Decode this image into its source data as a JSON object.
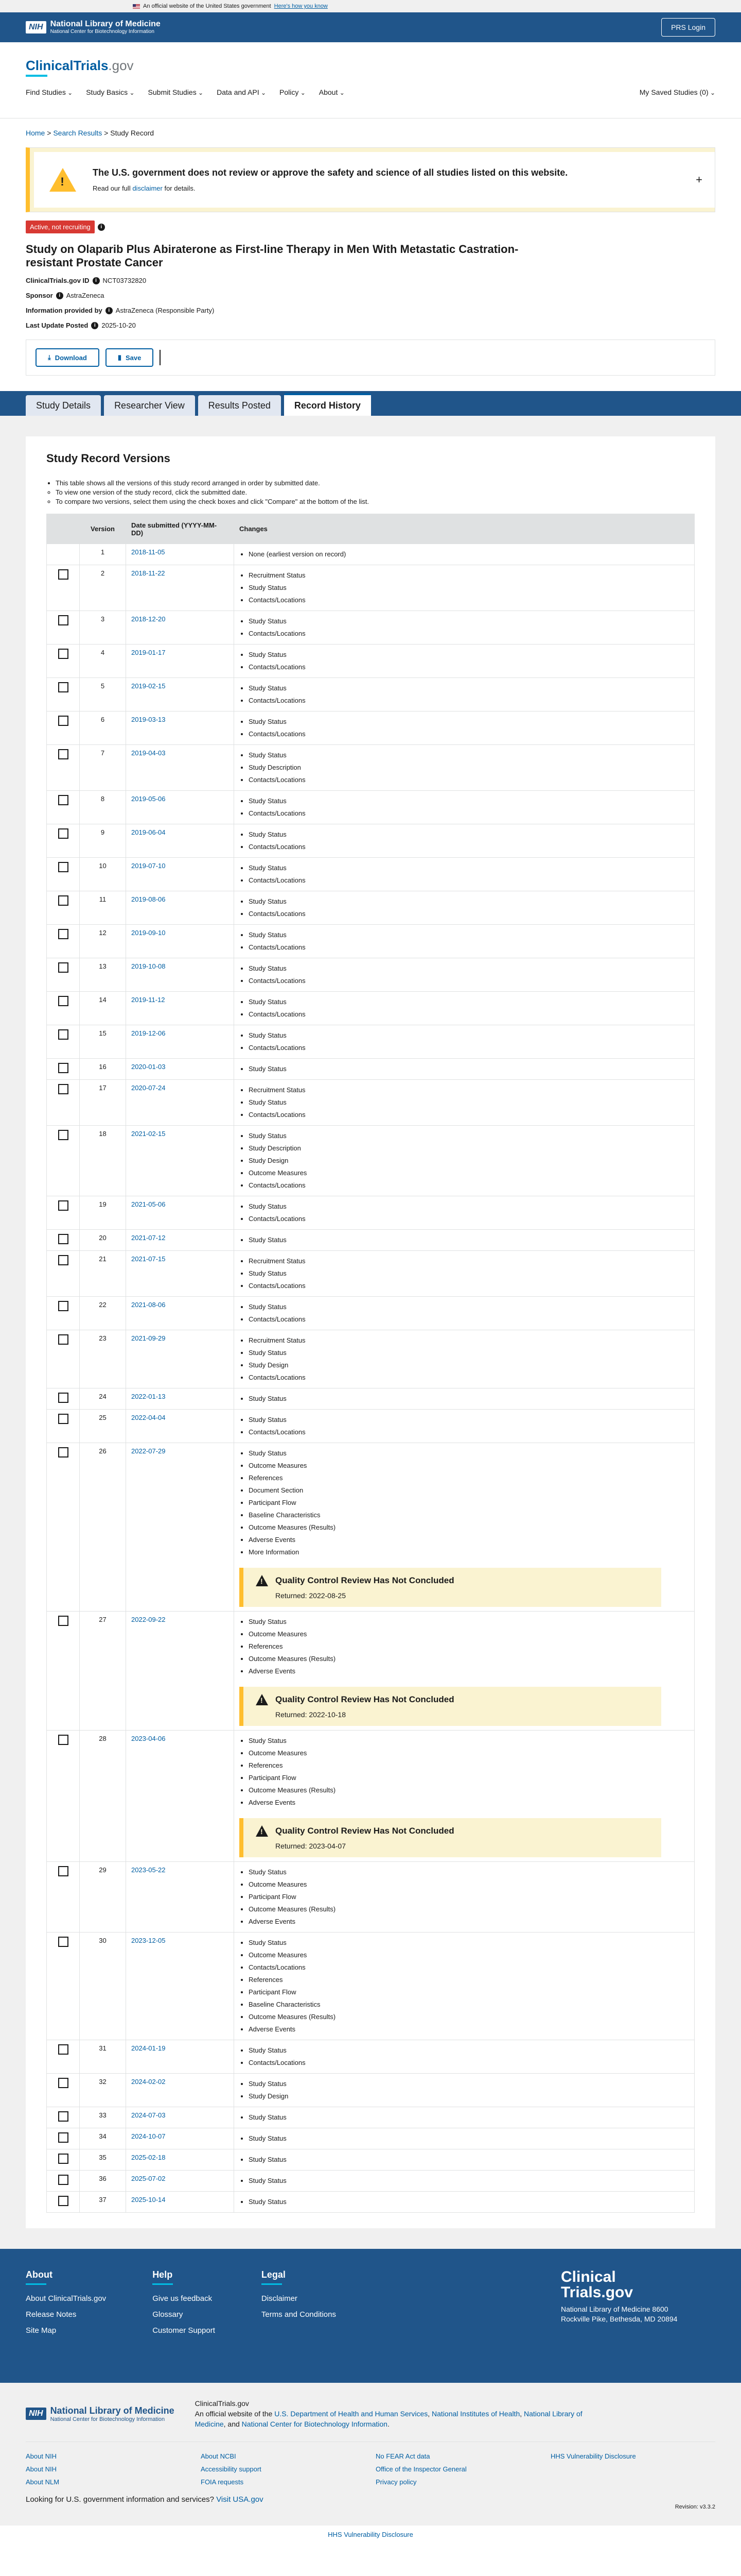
{
  "gov_banner": {
    "text": "An official website of the United States government",
    "link": "Here's how you know"
  },
  "nlm": {
    "nih": "NIH",
    "title": "National Library of Medicine",
    "subtitle": "National Center for Biotechnology Information",
    "login": "PRS Login"
  },
  "ct": {
    "logo_main": "ClinicalTrials",
    "logo_suffix": ".gov",
    "nav": [
      "Find Studies",
      "Study Basics",
      "Submit Studies",
      "Data and API",
      "Policy",
      "About"
    ],
    "saved": "My Saved Studies (0)"
  },
  "breadcrumb": {
    "home": "Home",
    "search": "Search Results",
    "current": "Study Record"
  },
  "notice": {
    "title": "The U.S. government does not review or approve the safety and science of all studies listed on this website.",
    "pre": "Read our full ",
    "link": "disclaimer",
    "post": " for details.",
    "toggle": "+"
  },
  "study": {
    "status": "Active, not recruiting",
    "title": "Study on Olaparib Plus Abiraterone as First-line Therapy in Men With Metastatic Castration-resistant Prostate Cancer",
    "id_label": "ClinicalTrials.gov ID",
    "id_value": "NCT03732820",
    "sponsor_label": "Sponsor",
    "sponsor_value": "AstraZeneca",
    "provided_label": "Information provided by",
    "provided_value": "AstraZeneca (Responsible Party)",
    "update_label": "Last Update Posted",
    "update_value": "2025-10-20",
    "download": "Download",
    "save": "Save"
  },
  "tabs": [
    "Study Details",
    "Researcher View",
    "Results Posted",
    "Record History"
  ],
  "history": {
    "title": "Study Record Versions",
    "instr1": "This table shows all the versions of this study record arranged in order by submitted date.",
    "instr2": "To view one version of the study record, click the submitted date.",
    "instr3": "To compare two versions, select them using the check boxes and click \"Compare\" at the bottom of the list.",
    "col_version": "Version",
    "col_date": "Date submitted (YYYY-MM-DD)",
    "col_changes": "Changes",
    "qc_title": "Quality Control Review Has Not Concluded",
    "rows": [
      {
        "v": "1",
        "d": "2018-11-05",
        "c": [
          "None (earliest version on record)"
        ],
        "noChk": true
      },
      {
        "v": "2",
        "d": "2018-11-22",
        "c": [
          "Recruitment Status",
          "Study Status",
          "Contacts/Locations"
        ]
      },
      {
        "v": "3",
        "d": "2018-12-20",
        "c": [
          "Study Status",
          "Contacts/Locations"
        ]
      },
      {
        "v": "4",
        "d": "2019-01-17",
        "c": [
          "Study Status",
          "Contacts/Locations"
        ]
      },
      {
        "v": "5",
        "d": "2019-02-15",
        "c": [
          "Study Status",
          "Contacts/Locations"
        ]
      },
      {
        "v": "6",
        "d": "2019-03-13",
        "c": [
          "Study Status",
          "Contacts/Locations"
        ]
      },
      {
        "v": "7",
        "d": "2019-04-03",
        "c": [
          "Study Status",
          "Study Description",
          "Contacts/Locations"
        ]
      },
      {
        "v": "8",
        "d": "2019-05-06",
        "c": [
          "Study Status",
          "Contacts/Locations"
        ]
      },
      {
        "v": "9",
        "d": "2019-06-04",
        "c": [
          "Study Status",
          "Contacts/Locations"
        ]
      },
      {
        "v": "10",
        "d": "2019-07-10",
        "c": [
          "Study Status",
          "Contacts/Locations"
        ]
      },
      {
        "v": "11",
        "d": "2019-08-06",
        "c": [
          "Study Status",
          "Contacts/Locations"
        ]
      },
      {
        "v": "12",
        "d": "2019-09-10",
        "c": [
          "Study Status",
          "Contacts/Locations"
        ]
      },
      {
        "v": "13",
        "d": "2019-10-08",
        "c": [
          "Study Status",
          "Contacts/Locations"
        ]
      },
      {
        "v": "14",
        "d": "2019-11-12",
        "c": [
          "Study Status",
          "Contacts/Locations"
        ]
      },
      {
        "v": "15",
        "d": "2019-12-06",
        "c": [
          "Study Status",
          "Contacts/Locations"
        ]
      },
      {
        "v": "16",
        "d": "2020-01-03",
        "c": [
          "Study Status"
        ]
      },
      {
        "v": "17",
        "d": "2020-07-24",
        "c": [
          "Recruitment Status",
          "Study Status",
          "Contacts/Locations"
        ]
      },
      {
        "v": "18",
        "d": "2021-02-15",
        "c": [
          "Study Status",
          "Study Description",
          "Study Design",
          "Outcome Measures",
          "Contacts/Locations"
        ]
      },
      {
        "v": "19",
        "d": "2021-05-06",
        "c": [
          "Study Status",
          "Contacts/Locations"
        ]
      },
      {
        "v": "20",
        "d": "2021-07-12",
        "c": [
          "Study Status"
        ]
      },
      {
        "v": "21",
        "d": "2021-07-15",
        "c": [
          "Recruitment Status",
          "Study Status",
          "Contacts/Locations"
        ]
      },
      {
        "v": "22",
        "d": "2021-08-06",
        "c": [
          "Study Status",
          "Contacts/Locations"
        ]
      },
      {
        "v": "23",
        "d": "2021-09-29",
        "c": [
          "Recruitment Status",
          "Study Status",
          "Study Design",
          "Contacts/Locations"
        ]
      },
      {
        "v": "24",
        "d": "2022-01-13",
        "c": [
          "Study Status"
        ]
      },
      {
        "v": "25",
        "d": "2022-04-04",
        "c": [
          "Study Status",
          "Contacts/Locations"
        ]
      },
      {
        "v": "26",
        "d": "2022-07-29",
        "c": [
          "Study Status",
          "Outcome Measures",
          "References",
          "Document Section",
          "Participant Flow",
          "Baseline Characteristics",
          "Outcome Measures (Results)",
          "Adverse Events",
          "More Information"
        ],
        "qc": "Returned: 2022-08-25"
      },
      {
        "v": "27",
        "d": "2022-09-22",
        "c": [
          "Study Status",
          "Outcome Measures",
          "References",
          "Outcome Measures (Results)",
          "Adverse Events"
        ],
        "qc": "Returned: 2022-10-18"
      },
      {
        "v": "28",
        "d": "2023-04-06",
        "c": [
          "Study Status",
          "Outcome Measures",
          "References",
          "Participant Flow",
          "Outcome Measures (Results)",
          "Adverse Events"
        ],
        "qc": "Returned: 2023-04-07"
      },
      {
        "v": "29",
        "d": "2023-05-22",
        "c": [
          "Study Status",
          "Outcome Measures",
          "Participant Flow",
          "Outcome Measures (Results)",
          "Adverse Events"
        ]
      },
      {
        "v": "30",
        "d": "2023-12-05",
        "c": [
          "Study Status",
          "Outcome Measures",
          "Contacts/Locations",
          "References",
          "Participant Flow",
          "Baseline Characteristics",
          "Outcome Measures (Results)",
          "Adverse Events"
        ]
      },
      {
        "v": "31",
        "d": "2024-01-19",
        "c": [
          "Study Status",
          "Contacts/Locations"
        ]
      },
      {
        "v": "32",
        "d": "2024-02-02",
        "c": [
          "Study Status",
          "Study Design"
        ]
      },
      {
        "v": "33",
        "d": "2024-07-03",
        "c": [
          "Study Status"
        ]
      },
      {
        "v": "34",
        "d": "2024-10-07",
        "c": [
          "Study Status"
        ]
      },
      {
        "v": "35",
        "d": "2025-02-18",
        "c": [
          "Study Status"
        ]
      },
      {
        "v": "36",
        "d": "2025-07-02",
        "c": [
          "Study Status"
        ]
      },
      {
        "v": "37",
        "d": "2025-10-14",
        "c": [
          "Study Status"
        ]
      }
    ]
  },
  "footer": {
    "about_title": "About",
    "about_links": [
      "About ClinicalTrials.gov",
      "Release Notes",
      "Site Map"
    ],
    "help_title": "Help",
    "help_links": [
      "Give us feedback",
      "Glossary",
      "Customer Support"
    ],
    "legal_title": "Legal",
    "legal_links": [
      "Disclaimer",
      "Terms and Conditions"
    ],
    "logo_l1": "Clinical",
    "logo_l2": "Trials.gov",
    "addr": "National Library of Medicine 8600 Rockville Pike, Bethesda, MD 20894"
  },
  "nlm_footer": {
    "ct": "ClinicalTrials.gov",
    "desc_pre": "An official website of the ",
    "hhs": "U.S. Department of Health and Human Services",
    "nih": "National Institutes of Health",
    "nlm": "National Library of Medicine",
    "ncbi": "National Center for Biotechnology Information",
    "links": [
      "About NIH",
      "About NCBI",
      "No FEAR Act data",
      "HHS Vulnerability Disclosure",
      "About NIH",
      "Accessibility support",
      "Office of the Inspector General",
      "",
      "About NLM",
      "FOIA requests",
      "Privacy policy",
      ""
    ],
    "look": "Looking for U.S. government information and services?",
    "usa": "Visit USA.gov",
    "revision": "Revision: v3.3.2",
    "vuln": "HHS Vulnerability Disclosure"
  }
}
